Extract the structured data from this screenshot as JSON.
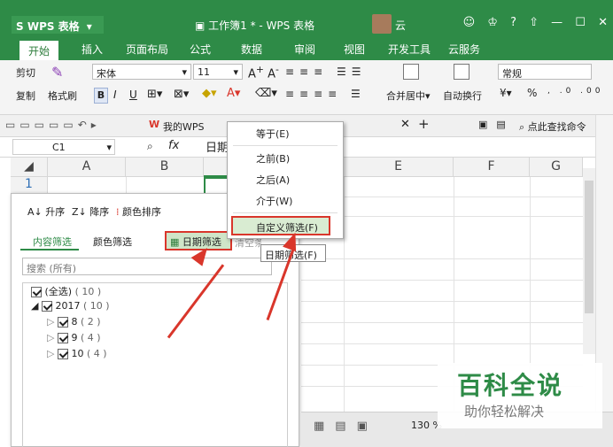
{
  "app": {
    "logo": "WPS 表格",
    "title": "工作簿1 * - WPS 表格",
    "user": "云"
  },
  "tabs": [
    "开始",
    "插入",
    "页面布局",
    "公式",
    "数据",
    "审阅",
    "视图",
    "开发工具",
    "云服务"
  ],
  "ribbon": {
    "cut": "剪切",
    "copy": "复制",
    "format_painter": "格式刷",
    "font": "宋体",
    "size": "11",
    "bold": "B",
    "italic": "I",
    "underline": "U",
    "merge": "合并居中",
    "wrap": "自动换行",
    "number_format": "常规",
    "percent": "%"
  },
  "quickbar": {
    "mywps": "我的WPS",
    "search": "点此查找命令"
  },
  "formula": {
    "cell": "C1",
    "fx": "fx",
    "value": "日期"
  },
  "columns": [
    "A",
    "B",
    "E",
    "F",
    "G"
  ],
  "row1": "1",
  "filter": {
    "sort_asc": "升序",
    "sort_desc": "降序",
    "sort_color": "颜色排序",
    "tab_content": "内容筛选",
    "tab_color": "颜色筛选",
    "date_filter": "日期筛选",
    "clear": "清空条件",
    "search_placeholder": "搜索 (所有)",
    "tree": [
      {
        "label": "(全选)",
        "count": "( 10 )"
      },
      {
        "label": "2017",
        "count": "( 10 )"
      },
      {
        "label": "8",
        "count": "( 2 )"
      },
      {
        "label": "9",
        "count": "( 4 )"
      },
      {
        "label": "10",
        "count": "( 4 )"
      }
    ]
  },
  "dropdown": {
    "items": [
      "等于(E)",
      "之前(B)",
      "之后(A)",
      "介于(W)",
      "自定义筛选(F)"
    ]
  },
  "tooltip": "日期筛选(F)",
  "status": {
    "zoom": "130 %"
  },
  "watermark": {
    "main": "百科全说",
    "sub": "助你轻松解决"
  },
  "colors": {
    "green": "#2e8b47",
    "red": "#d9362b"
  }
}
